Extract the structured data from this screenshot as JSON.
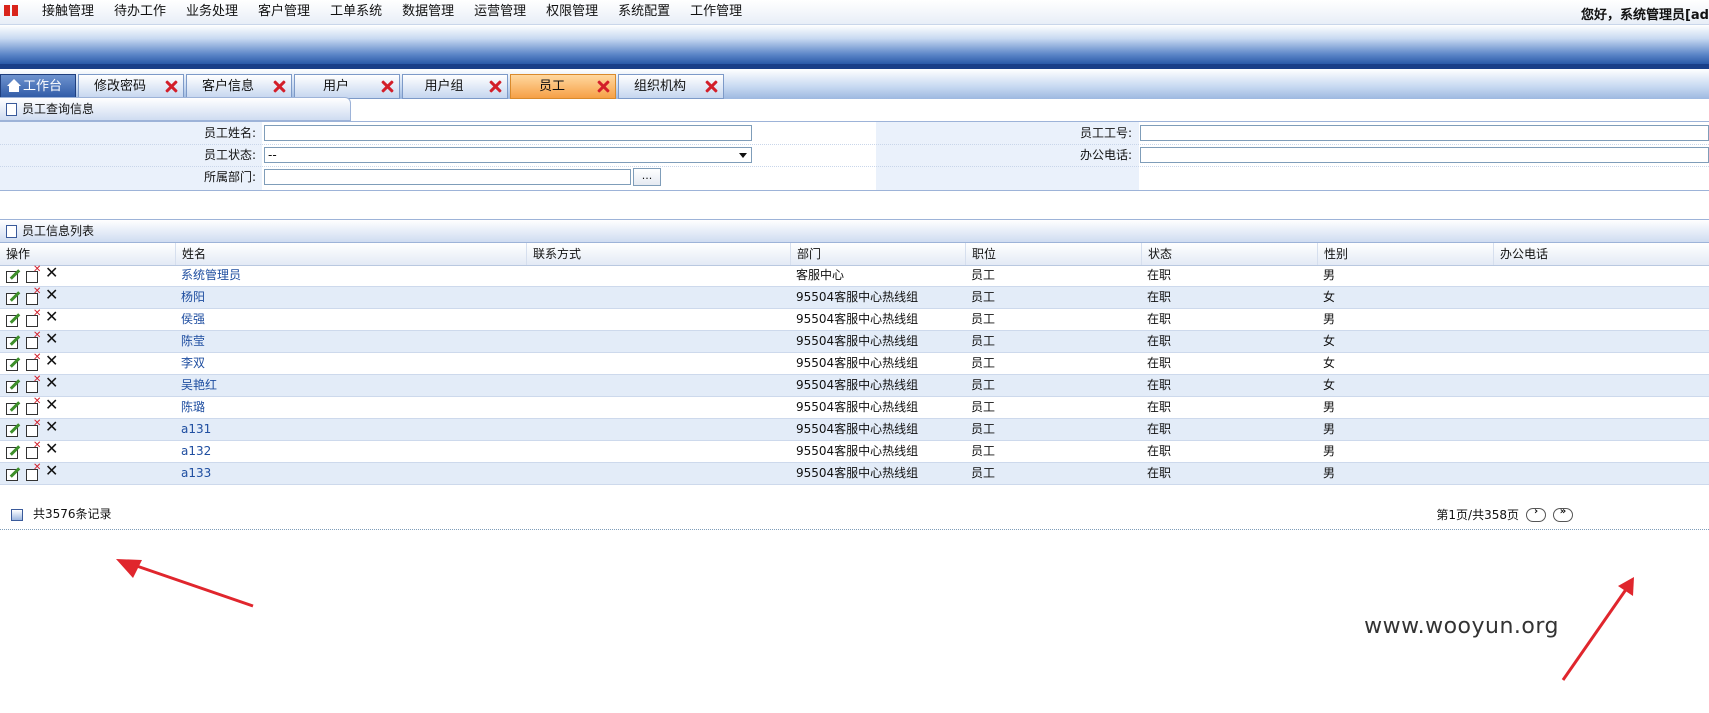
{
  "menu": {
    "items": [
      "接触管理",
      "待办工作",
      "业务处理",
      "客户管理",
      "工单系统",
      "数据管理",
      "运营管理",
      "权限管理",
      "系统配置",
      "工作管理"
    ],
    "greeting": "您好，系统管理员[ad"
  },
  "tabs": [
    {
      "label": "工作台",
      "home": true
    },
    {
      "label": "修改密码"
    },
    {
      "label": "客户信息"
    },
    {
      "label": "用户"
    },
    {
      "label": "用户组"
    },
    {
      "label": "员工",
      "active": true
    },
    {
      "label": "组织机构"
    }
  ],
  "search_panel": {
    "title": "员工查询信息",
    "name_label": "员工姓名:",
    "name_value": "",
    "status_label": "员工状态:",
    "status_value": "--",
    "dept_label": "所属部门:",
    "dept_value": "",
    "browse_label": "...",
    "id_label": "员工工号:",
    "id_value": "",
    "phone_label": "办公电话:",
    "phone_value": ""
  },
  "list_panel": {
    "title": "员工信息列表",
    "columns": [
      "操作",
      "姓名",
      "联系方式",
      "部门",
      "职位",
      "状态",
      "性别",
      "办公电话"
    ],
    "rows": [
      {
        "name": "系统管理员",
        "contact": "",
        "dept": "客服中心",
        "position": "员工",
        "status": "在职",
        "gender": "男",
        "phone": ""
      },
      {
        "name": "杨阳",
        "contact": "",
        "dept": "95504客服中心热线组",
        "position": "员工",
        "status": "在职",
        "gender": "女",
        "phone": ""
      },
      {
        "name": "侯强",
        "contact": "",
        "dept": "95504客服中心热线组",
        "position": "员工",
        "status": "在职",
        "gender": "男",
        "phone": ""
      },
      {
        "name": "陈莹",
        "contact": "",
        "dept": "95504客服中心热线组",
        "position": "员工",
        "status": "在职",
        "gender": "女",
        "phone": ""
      },
      {
        "name": "李双",
        "contact": "",
        "dept": "95504客服中心热线组",
        "position": "员工",
        "status": "在职",
        "gender": "女",
        "phone": ""
      },
      {
        "name": "吴艳红",
        "contact": "",
        "dept": "95504客服中心热线组",
        "position": "员工",
        "status": "在职",
        "gender": "女",
        "phone": ""
      },
      {
        "name": "陈璐",
        "contact": "",
        "dept": "95504客服中心热线组",
        "position": "员工",
        "status": "在职",
        "gender": "男",
        "phone": ""
      },
      {
        "name": "a131",
        "contact": "",
        "dept": "95504客服中心热线组",
        "position": "员工",
        "status": "在职",
        "gender": "男",
        "phone": ""
      },
      {
        "name": "a132",
        "contact": "",
        "dept": "95504客服中心热线组",
        "position": "员工",
        "status": "在职",
        "gender": "男",
        "phone": ""
      },
      {
        "name": "a133",
        "contact": "",
        "dept": "95504客服中心热线组",
        "position": "员工",
        "status": "在职",
        "gender": "男",
        "phone": ""
      }
    ]
  },
  "pager": {
    "total_text": "共3576条记录",
    "page_text": "第1页/共358页",
    "current_page": 1,
    "total_pages": 358,
    "total_records": 3576
  },
  "watermark": "www.wooyun.org",
  "colors": {
    "accent": "#2b5aa8",
    "active_tab": "#f6a046",
    "close_x": "#d31f2a",
    "link": "#1f4ea0",
    "arrow": "#e0262d"
  }
}
